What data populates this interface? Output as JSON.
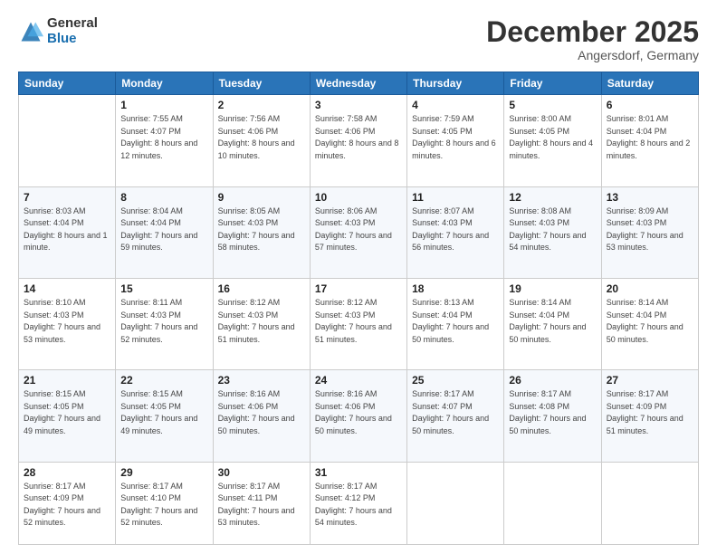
{
  "logo": {
    "general": "General",
    "blue": "Blue"
  },
  "title": "December 2025",
  "location": "Angersdorf, Germany",
  "weekdays": [
    "Sunday",
    "Monday",
    "Tuesday",
    "Wednesday",
    "Thursday",
    "Friday",
    "Saturday"
  ],
  "weeks": [
    [
      {
        "day": "",
        "sunrise": "",
        "sunset": "",
        "daylight": ""
      },
      {
        "day": "1",
        "sunrise": "Sunrise: 7:55 AM",
        "sunset": "Sunset: 4:07 PM",
        "daylight": "Daylight: 8 hours and 12 minutes."
      },
      {
        "day": "2",
        "sunrise": "Sunrise: 7:56 AM",
        "sunset": "Sunset: 4:06 PM",
        "daylight": "Daylight: 8 hours and 10 minutes."
      },
      {
        "day": "3",
        "sunrise": "Sunrise: 7:58 AM",
        "sunset": "Sunset: 4:06 PM",
        "daylight": "Daylight: 8 hours and 8 minutes."
      },
      {
        "day": "4",
        "sunrise": "Sunrise: 7:59 AM",
        "sunset": "Sunset: 4:05 PM",
        "daylight": "Daylight: 8 hours and 6 minutes."
      },
      {
        "day": "5",
        "sunrise": "Sunrise: 8:00 AM",
        "sunset": "Sunset: 4:05 PM",
        "daylight": "Daylight: 8 hours and 4 minutes."
      },
      {
        "day": "6",
        "sunrise": "Sunrise: 8:01 AM",
        "sunset": "Sunset: 4:04 PM",
        "daylight": "Daylight: 8 hours and 2 minutes."
      }
    ],
    [
      {
        "day": "7",
        "sunrise": "Sunrise: 8:03 AM",
        "sunset": "Sunset: 4:04 PM",
        "daylight": "Daylight: 8 hours and 1 minute."
      },
      {
        "day": "8",
        "sunrise": "Sunrise: 8:04 AM",
        "sunset": "Sunset: 4:04 PM",
        "daylight": "Daylight: 7 hours and 59 minutes."
      },
      {
        "day": "9",
        "sunrise": "Sunrise: 8:05 AM",
        "sunset": "Sunset: 4:03 PM",
        "daylight": "Daylight: 7 hours and 58 minutes."
      },
      {
        "day": "10",
        "sunrise": "Sunrise: 8:06 AM",
        "sunset": "Sunset: 4:03 PM",
        "daylight": "Daylight: 7 hours and 57 minutes."
      },
      {
        "day": "11",
        "sunrise": "Sunrise: 8:07 AM",
        "sunset": "Sunset: 4:03 PM",
        "daylight": "Daylight: 7 hours and 56 minutes."
      },
      {
        "day": "12",
        "sunrise": "Sunrise: 8:08 AM",
        "sunset": "Sunset: 4:03 PM",
        "daylight": "Daylight: 7 hours and 54 minutes."
      },
      {
        "day": "13",
        "sunrise": "Sunrise: 8:09 AM",
        "sunset": "Sunset: 4:03 PM",
        "daylight": "Daylight: 7 hours and 53 minutes."
      }
    ],
    [
      {
        "day": "14",
        "sunrise": "Sunrise: 8:10 AM",
        "sunset": "Sunset: 4:03 PM",
        "daylight": "Daylight: 7 hours and 53 minutes."
      },
      {
        "day": "15",
        "sunrise": "Sunrise: 8:11 AM",
        "sunset": "Sunset: 4:03 PM",
        "daylight": "Daylight: 7 hours and 52 minutes."
      },
      {
        "day": "16",
        "sunrise": "Sunrise: 8:12 AM",
        "sunset": "Sunset: 4:03 PM",
        "daylight": "Daylight: 7 hours and 51 minutes."
      },
      {
        "day": "17",
        "sunrise": "Sunrise: 8:12 AM",
        "sunset": "Sunset: 4:03 PM",
        "daylight": "Daylight: 7 hours and 51 minutes."
      },
      {
        "day": "18",
        "sunrise": "Sunrise: 8:13 AM",
        "sunset": "Sunset: 4:04 PM",
        "daylight": "Daylight: 7 hours and 50 minutes."
      },
      {
        "day": "19",
        "sunrise": "Sunrise: 8:14 AM",
        "sunset": "Sunset: 4:04 PM",
        "daylight": "Daylight: 7 hours and 50 minutes."
      },
      {
        "day": "20",
        "sunrise": "Sunrise: 8:14 AM",
        "sunset": "Sunset: 4:04 PM",
        "daylight": "Daylight: 7 hours and 50 minutes."
      }
    ],
    [
      {
        "day": "21",
        "sunrise": "Sunrise: 8:15 AM",
        "sunset": "Sunset: 4:05 PM",
        "daylight": "Daylight: 7 hours and 49 minutes."
      },
      {
        "day": "22",
        "sunrise": "Sunrise: 8:15 AM",
        "sunset": "Sunset: 4:05 PM",
        "daylight": "Daylight: 7 hours and 49 minutes."
      },
      {
        "day": "23",
        "sunrise": "Sunrise: 8:16 AM",
        "sunset": "Sunset: 4:06 PM",
        "daylight": "Daylight: 7 hours and 50 minutes."
      },
      {
        "day": "24",
        "sunrise": "Sunrise: 8:16 AM",
        "sunset": "Sunset: 4:06 PM",
        "daylight": "Daylight: 7 hours and 50 minutes."
      },
      {
        "day": "25",
        "sunrise": "Sunrise: 8:17 AM",
        "sunset": "Sunset: 4:07 PM",
        "daylight": "Daylight: 7 hours and 50 minutes."
      },
      {
        "day": "26",
        "sunrise": "Sunrise: 8:17 AM",
        "sunset": "Sunset: 4:08 PM",
        "daylight": "Daylight: 7 hours and 50 minutes."
      },
      {
        "day": "27",
        "sunrise": "Sunrise: 8:17 AM",
        "sunset": "Sunset: 4:09 PM",
        "daylight": "Daylight: 7 hours and 51 minutes."
      }
    ],
    [
      {
        "day": "28",
        "sunrise": "Sunrise: 8:17 AM",
        "sunset": "Sunset: 4:09 PM",
        "daylight": "Daylight: 7 hours and 52 minutes."
      },
      {
        "day": "29",
        "sunrise": "Sunrise: 8:17 AM",
        "sunset": "Sunset: 4:10 PM",
        "daylight": "Daylight: 7 hours and 52 minutes."
      },
      {
        "day": "30",
        "sunrise": "Sunrise: 8:17 AM",
        "sunset": "Sunset: 4:11 PM",
        "daylight": "Daylight: 7 hours and 53 minutes."
      },
      {
        "day": "31",
        "sunrise": "Sunrise: 8:17 AM",
        "sunset": "Sunset: 4:12 PM",
        "daylight": "Daylight: 7 hours and 54 minutes."
      },
      {
        "day": "",
        "sunrise": "",
        "sunset": "",
        "daylight": ""
      },
      {
        "day": "",
        "sunrise": "",
        "sunset": "",
        "daylight": ""
      },
      {
        "day": "",
        "sunrise": "",
        "sunset": "",
        "daylight": ""
      }
    ]
  ]
}
